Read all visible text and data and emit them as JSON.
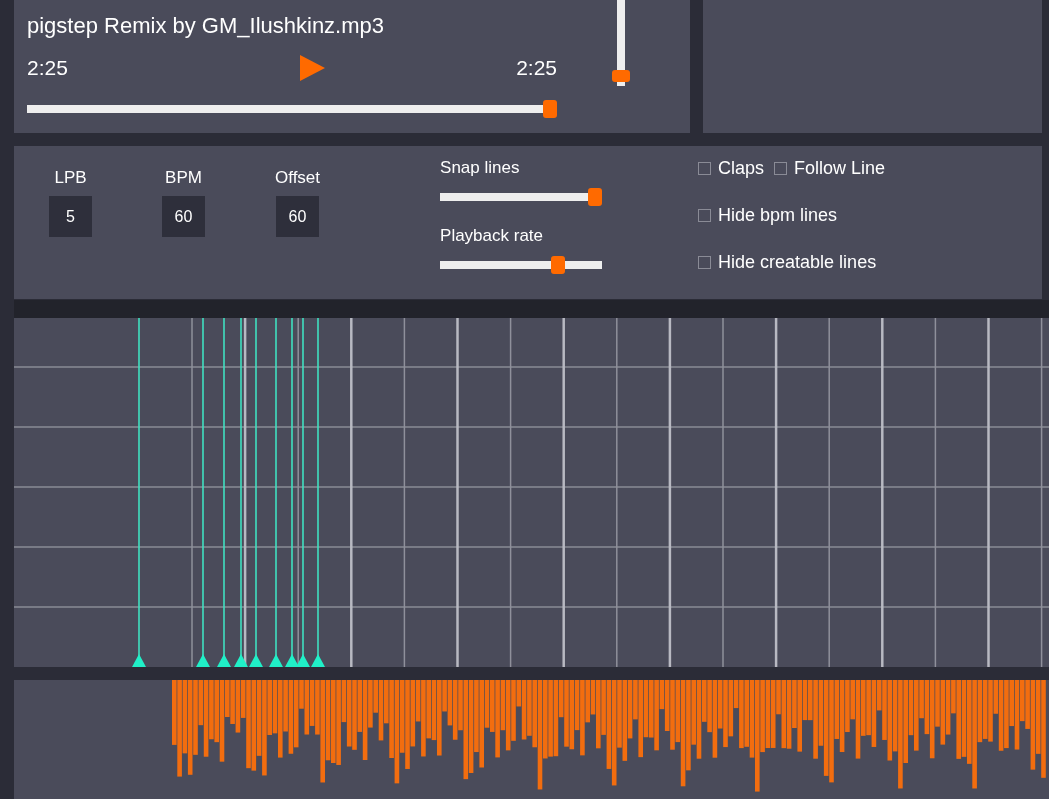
{
  "player": {
    "title": "pigstep Remix by GM_Ilushkinz.mp3",
    "current_time": "2:25",
    "total_time": "2:25",
    "seek": {
      "level": 1.0
    },
    "volume": {
      "level": 0.05
    }
  },
  "settings": {
    "fields": [
      {
        "label": "LPB",
        "value": "5"
      },
      {
        "label": "BPM",
        "value": "60"
      },
      {
        "label": "Offset",
        "value": "60"
      }
    ],
    "sliders": [
      {
        "label": "Snap lines",
        "level": 1.0
      },
      {
        "label": "Playback rate",
        "level": 0.75
      }
    ],
    "checkbox_rows": [
      [
        {
          "label": "Claps",
          "checked": false
        },
        {
          "label": "Follow Line",
          "checked": false
        }
      ],
      [
        {
          "label": "Hide bpm lines",
          "checked": false
        }
      ],
      [
        {
          "label": "Hide creatable lines",
          "checked": false
        }
      ]
    ]
  }
}
